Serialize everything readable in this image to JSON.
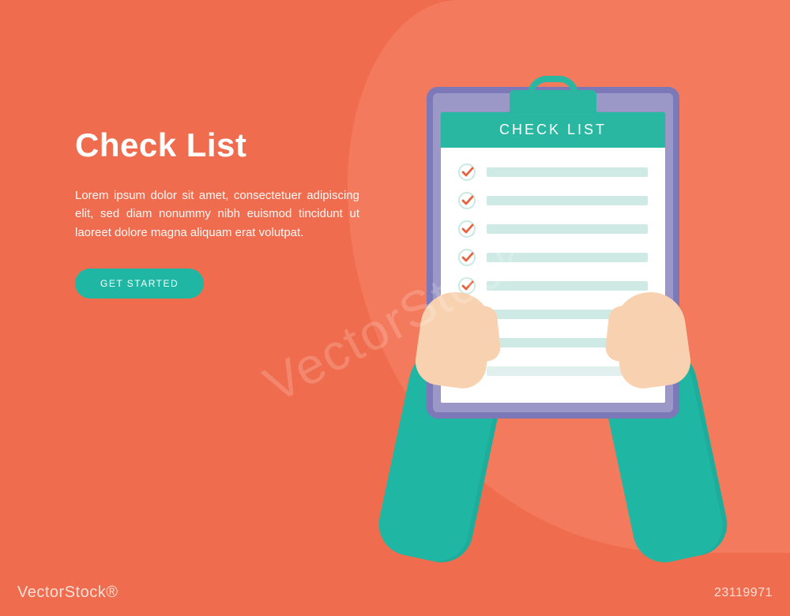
{
  "hero": {
    "title": "Check List",
    "body": "Lorem ipsum dolor sit amet, consectetuer adipiscing elit, sed diam nonummy nibh euismod tincidunt ut laoreet dolore magna aliquam erat volutpat.",
    "cta": "GET STARTED"
  },
  "clipboard": {
    "heading": "CHECK LIST",
    "rows": [
      {
        "checked": true
      },
      {
        "checked": true
      },
      {
        "checked": true
      },
      {
        "checked": true
      },
      {
        "checked": true
      },
      {
        "checked": true
      },
      {
        "checked": true
      },
      {
        "checked": false
      }
    ]
  },
  "watermark": {
    "brand": "VectorStock®",
    "id": "23119971",
    "center": "VectorStock"
  }
}
